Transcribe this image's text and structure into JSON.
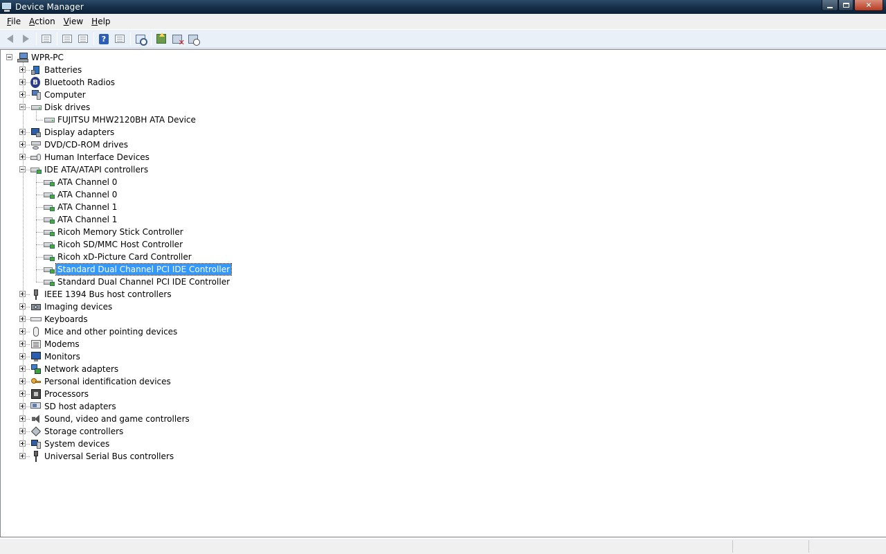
{
  "window": {
    "title": "Device Manager",
    "minimize": "minimize",
    "maximize": "maximize",
    "close": "✕"
  },
  "menu": [
    {
      "label": "File",
      "accel": "F",
      "rest": "ile"
    },
    {
      "label": "Action",
      "accel": "A",
      "rest": "ction"
    },
    {
      "label": "View",
      "accel": "V",
      "rest": "iew"
    },
    {
      "label": "Help",
      "accel": "H",
      "rest": "elp"
    }
  ],
  "toolbar": {
    "buttons": [
      "back",
      "forward",
      "up",
      "properties",
      "show-hide-console-tree",
      "help",
      "scan-for-hardware-changes",
      "update-driver",
      "uninstall",
      "disable"
    ]
  },
  "tree": {
    "root": "WPR-PC",
    "selected": "Standard Dual Channel PCI IDE Controller",
    "categories": [
      {
        "label": "Batteries",
        "icon": "battery-icon",
        "expanded": false
      },
      {
        "label": "Bluetooth Radios",
        "icon": "bluetooth-icon",
        "expanded": false
      },
      {
        "label": "Computer",
        "icon": "computer-icon",
        "expanded": false
      },
      {
        "label": "Disk drives",
        "icon": "disk-drive-icon",
        "expanded": true,
        "children": [
          "FUJITSU MHW2120BH ATA Device"
        ]
      },
      {
        "label": "Display adapters",
        "icon": "display-adapter-icon",
        "expanded": false
      },
      {
        "label": "DVD/CD-ROM drives",
        "icon": "dvd-drive-icon",
        "expanded": false
      },
      {
        "label": "Human Interface Devices",
        "icon": "hid-icon",
        "expanded": false
      },
      {
        "label": "IDE ATA/ATAPI controllers",
        "icon": "ide-controller-icon",
        "expanded": true,
        "children": [
          "ATA Channel 0",
          "ATA Channel 0",
          "ATA Channel 1",
          "ATA Channel 1",
          "Ricoh Memory Stick Controller",
          "Ricoh SD/MMC Host Controller",
          "Ricoh xD-Picture Card Controller",
          "Standard Dual Channel PCI IDE Controller",
          "Standard Dual Channel PCI IDE Controller"
        ]
      },
      {
        "label": "IEEE 1394 Bus host controllers",
        "icon": "ieee1394-icon",
        "expanded": false
      },
      {
        "label": "Imaging devices",
        "icon": "imaging-device-icon",
        "expanded": false
      },
      {
        "label": "Keyboards",
        "icon": "keyboard-icon",
        "expanded": false
      },
      {
        "label": "Mice and other pointing devices",
        "icon": "mouse-icon",
        "expanded": false
      },
      {
        "label": "Modems",
        "icon": "modem-icon",
        "expanded": false
      },
      {
        "label": "Monitors",
        "icon": "monitor-icon",
        "expanded": false
      },
      {
        "label": "Network adapters",
        "icon": "network-adapter-icon",
        "expanded": false
      },
      {
        "label": "Personal identification devices",
        "icon": "personal-id-icon",
        "expanded": false
      },
      {
        "label": "Processors",
        "icon": "processor-icon",
        "expanded": false
      },
      {
        "label": "SD host adapters",
        "icon": "sd-host-icon",
        "expanded": false
      },
      {
        "label": "Sound, video and game controllers",
        "icon": "sound-icon",
        "expanded": false
      },
      {
        "label": "Storage controllers",
        "icon": "storage-controller-icon",
        "expanded": false
      },
      {
        "label": "System devices",
        "icon": "system-device-icon",
        "expanded": false
      },
      {
        "label": "Universal Serial Bus controllers",
        "icon": "usb-icon",
        "expanded": false
      }
    ]
  },
  "colors": {
    "selection": "#3399ff",
    "titlebar": "#17304a",
    "toolbar": "#eaf0f7"
  }
}
